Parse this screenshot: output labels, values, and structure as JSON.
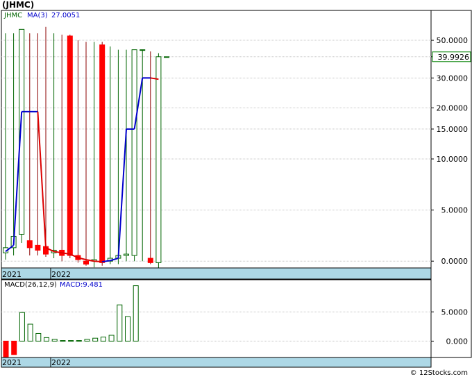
{
  "header": {
    "title": "(JHMC)"
  },
  "footer": {
    "credit": "© 12Stocks.com"
  },
  "colors": {
    "up": "#006400",
    "down": "#ff0000",
    "wick_up": "#006400",
    "wick_down": "#8b0000",
    "ma_up": "#0000cc",
    "ma_down": "#dd0000",
    "axis_band": "#add8e6",
    "price_box_border": "#008000"
  },
  "chart_data": [
    {
      "type": "candlestick",
      "scale": "log",
      "legend": {
        "ticker": "JHMC",
        "ma_label": "MA(3)",
        "ma_value": "27.0051",
        "position": "top-left"
      },
      "last_price_label": "39.9926",
      "yaxis_labels": [
        "50.0000",
        "40.0000",
        "30.0000",
        "20.0000",
        "15.0000",
        "10.0000",
        "5.0000",
        "0.0000"
      ],
      "ytick_values": [
        50,
        40,
        30,
        20,
        15,
        10,
        5,
        2.5
      ],
      "ylim": [
        2.28,
        75
      ],
      "grid": true,
      "xaxis_labels": [
        "2021",
        "2022"
      ],
      "candles": [
        {
          "o": 2.8,
          "h": 55,
          "l": 2.55,
          "c": 3.0
        },
        {
          "o": 3.0,
          "h": 55,
          "l": 2.7,
          "c": 3.5
        },
        {
          "o": 3.6,
          "h": 58,
          "l": 3.2,
          "c": 58
        },
        {
          "o": 3.3,
          "h": 55,
          "l": 2.7,
          "c": 3.0
        },
        {
          "o": 3.1,
          "h": 55,
          "l": 2.7,
          "c": 2.9
        },
        {
          "o": 3.05,
          "h": 60,
          "l": 2.65,
          "c": 2.75
        },
        {
          "o": 2.8,
          "h": 55,
          "l": 2.6,
          "c": 2.9
        },
        {
          "o": 2.9,
          "h": 54,
          "l": 2.5,
          "c": 2.7
        },
        {
          "o": 53,
          "h": 54,
          "l": 2.6,
          "c": 2.7
        },
        {
          "o": 2.7,
          "h": 50,
          "l": 2.45,
          "c": 2.55
        },
        {
          "o": 2.5,
          "h": 49,
          "l": 2.35,
          "c": 2.4
        },
        {
          "o": 2.5,
          "h": 49,
          "l": 2.3,
          "c": 2.55
        },
        {
          "o": 47,
          "h": 49,
          "l": 2.35,
          "c": 2.45
        },
        {
          "o": 2.5,
          "h": 46,
          "l": 2.4,
          "c": 2.6
        },
        {
          "o": 2.6,
          "h": 44,
          "l": 2.4,
          "c": 2.7
        },
        {
          "o": 2.7,
          "h": 44,
          "l": 2.5,
          "c": 2.75
        },
        {
          "o": 2.7,
          "h": 44,
          "l": 2.5,
          "c": 44
        },
        {
          "o": 44,
          "h": 44,
          "l": 2.5,
          "c": 44
        },
        {
          "o": 2.6,
          "h": 43,
          "l": 2.4,
          "c": 2.45
        },
        {
          "o": 2.45,
          "h": 42,
          "l": 2.2,
          "c": 40
        },
        {
          "o": 40,
          "h": 40,
          "l": 40,
          "c": 40
        }
      ],
      "ma": [
        2.85,
        3.1,
        19,
        19,
        19,
        3.0,
        2.85,
        2.8,
        2.75,
        2.62,
        2.55,
        2.5,
        2.48,
        2.52,
        2.6,
        15,
        15,
        30,
        30,
        29.5
      ],
      "series": [
        {
          "name": "JHMC",
          "kind": "candles"
        },
        {
          "name": "MA(3)",
          "kind": "line"
        }
      ]
    },
    {
      "type": "bar",
      "title_label": "MACD(26,12,9)",
      "value_label": "MACD:9.481",
      "yaxis_labels": [
        "5.0000",
        "0.000"
      ],
      "ytick_values": [
        5,
        0
      ],
      "ylim": [
        -2.8,
        10.5
      ],
      "xaxis_labels": [
        "2021",
        "2022"
      ],
      "values": [
        -3.5,
        -2.3,
        4.9,
        2.9,
        1.3,
        0.6,
        0.3,
        0.1,
        0.1,
        0.1,
        0.3,
        0.5,
        0.7,
        1.0,
        6.2,
        4.2,
        9.481
      ],
      "positions": [
        0,
        1,
        2,
        3,
        4,
        5,
        6,
        7,
        8,
        9,
        10,
        11,
        12,
        13,
        14,
        15,
        16
      ]
    }
  ]
}
